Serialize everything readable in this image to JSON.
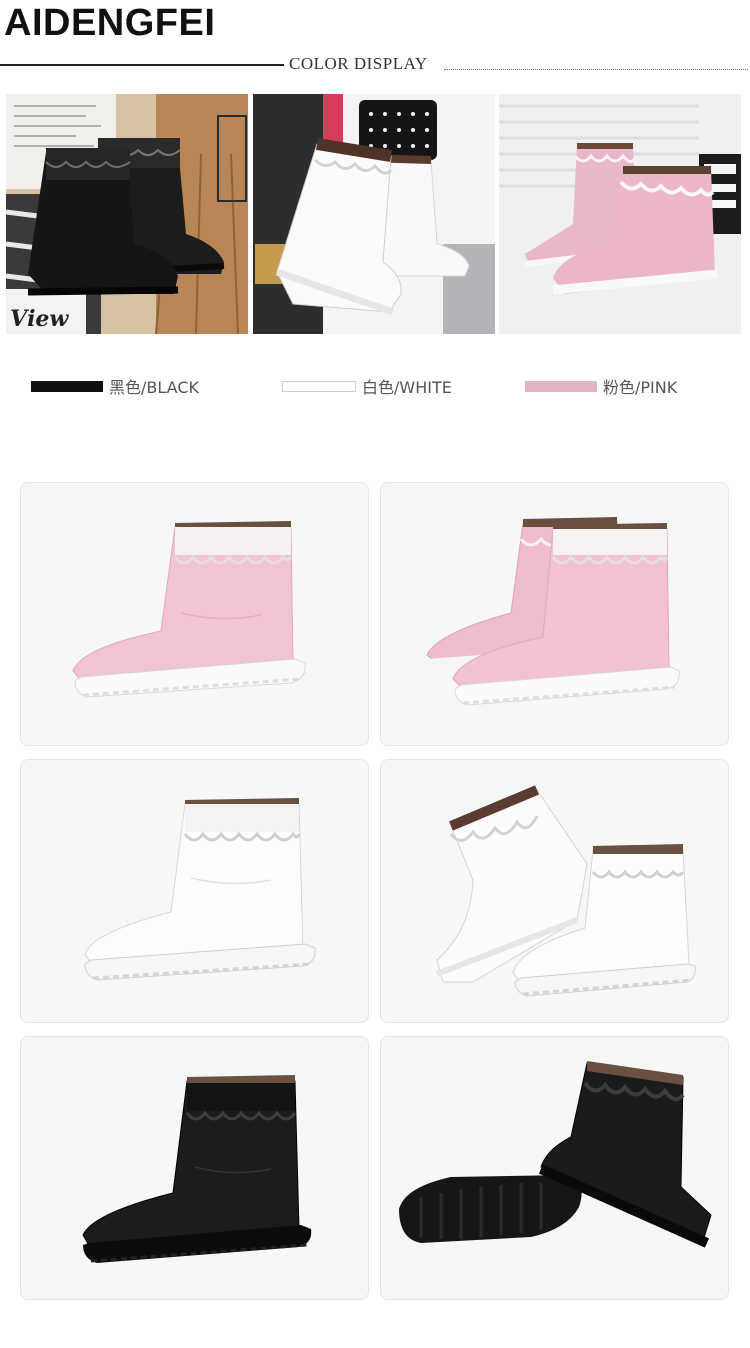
{
  "header": {
    "brand": "AIDENGFEI",
    "section_title": "COLOR DISPLAY"
  },
  "colors": [
    {
      "label": "黑色/BLACK",
      "hex": "#111111"
    },
    {
      "label": "白色/WHITE",
      "hex": "#ffffff"
    },
    {
      "label": "粉色/PINK",
      "hex": "#e2b5c4"
    }
  ],
  "photos": {
    "black_poster_text": "Ⅴiew"
  }
}
